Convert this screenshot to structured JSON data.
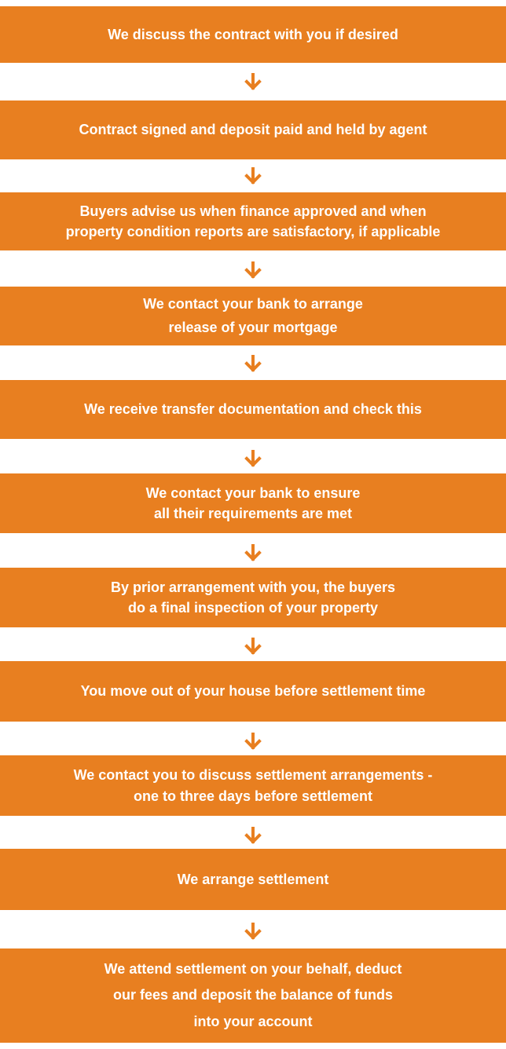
{
  "colors": {
    "box": "#e87f20",
    "text": "#ffffff",
    "arrow": "#e87f20",
    "background": "#ffffff"
  },
  "arrow_icon": "arrow-down-icon",
  "steps": [
    {
      "lines": [
        "We discuss the contract with you if desired"
      ]
    },
    {
      "lines": [
        "Contract signed and deposit paid and held by agent"
      ]
    },
    {
      "lines": [
        "Buyers advise us when finance approved and when",
        "property condition reports are satisfactory, if applicable"
      ]
    },
    {
      "lines": [
        "We contact your bank to arrange",
        "release of your mortgage"
      ]
    },
    {
      "lines": [
        "We receive transfer documentation and check this"
      ]
    },
    {
      "lines": [
        "We contact your bank to ensure",
        "all their requirements are met"
      ]
    },
    {
      "lines": [
        "By prior arrangement with you, the buyers",
        "do a final inspection of your property"
      ]
    },
    {
      "lines": [
        "You move out of your house before settlement time"
      ]
    },
    {
      "lines": [
        "We contact you to discuss settlement arrangements -",
        "one to three days before settlement"
      ]
    },
    {
      "lines": [
        "We arrange settlement"
      ]
    },
    {
      "lines": [
        "We attend settlement on your behalf, deduct",
        "our fees and deposit the balance of funds",
        "into your account"
      ]
    }
  ]
}
